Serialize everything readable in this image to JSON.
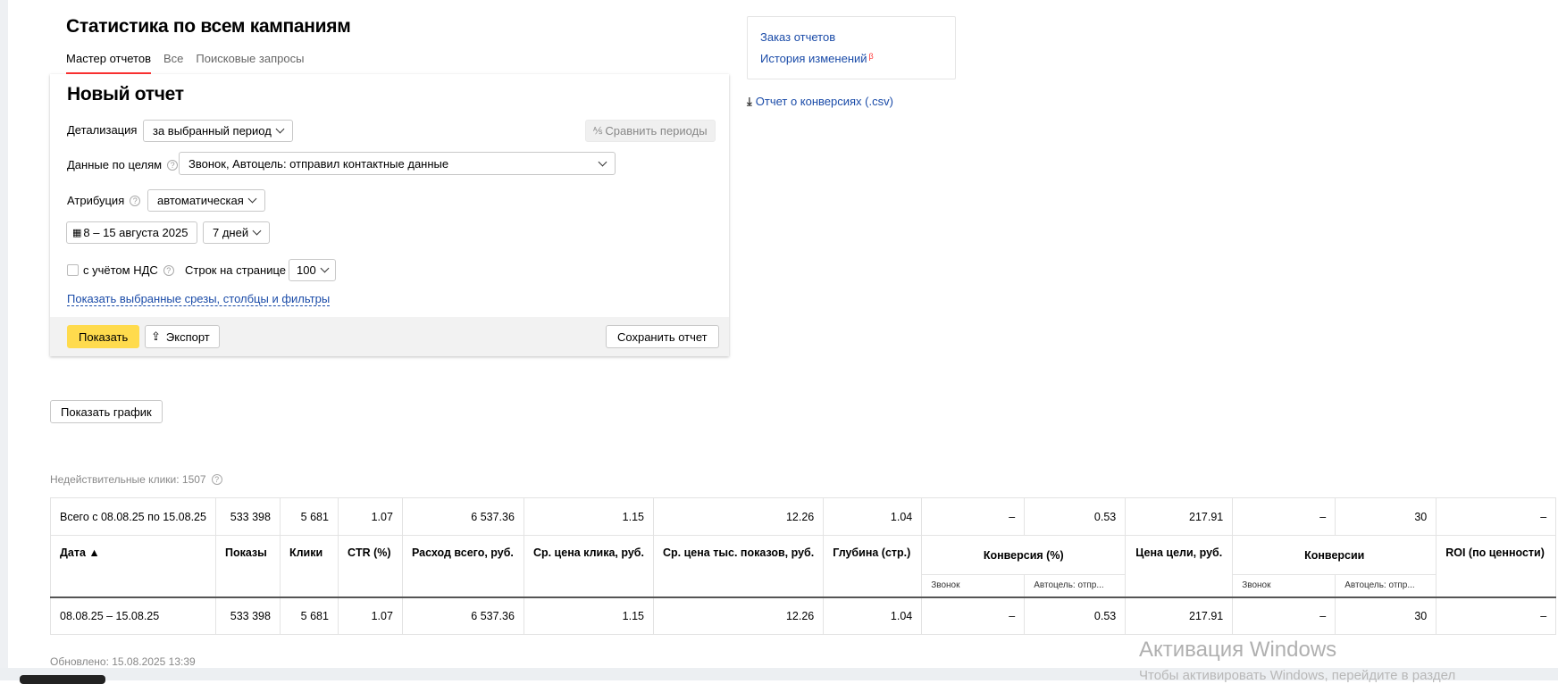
{
  "page_title": "Статистика по всем кампаниям",
  "tabs": [
    {
      "label": "Мастер отчетов",
      "active": true
    },
    {
      "label": "Все",
      "active": false
    },
    {
      "label": "Поисковые запросы",
      "active": false
    }
  ],
  "report": {
    "title": "Новый отчет",
    "detail_label": "Детализация",
    "detail_value": "за выбранный период",
    "compare_label": "Сравнить периоды",
    "goals_label": "Данные по целям",
    "goals_value": "Звонок, Автоцель: отправил контактные данные",
    "attribution_label": "Атрибуция",
    "attribution_value": "автоматическая",
    "date_range": "8 – 15 августа 2025",
    "period": "7 дней",
    "vat_label": "с учётом НДС",
    "vat_checked": false,
    "rows_label": "Строк на странице",
    "rows_value": "100",
    "show_filters_link": "Показать выбранные срезы, столбцы и фильтры",
    "show_button": "Показать",
    "export_button": "Экспорт",
    "save_button": "Сохранить отчет"
  },
  "side": {
    "order_reports": "Заказ отчетов",
    "history": "История изменений",
    "beta": "β",
    "conversions_csv": "Отчет о конверсиях (.csv)"
  },
  "show_chart_button": "Показать график",
  "invalid_clicks": "Недействительные клики: 1507",
  "table": {
    "total_row": [
      "Всего с 08.08.25 по 15.08.25",
      "533 398",
      "5 681",
      "1.07",
      "6 537.36",
      "1.15",
      "12.26",
      "1.04",
      "–",
      "0.53",
      "217.91",
      "–",
      "30",
      "–"
    ],
    "headers": {
      "date": "Дата ▲",
      "impressions": "Показы",
      "clicks": "Клики",
      "ctr": "CTR (%)",
      "cost": "Расход всего, руб.",
      "cpc": "Ср. цена клика, руб.",
      "cpm": "Ср. цена тыс. показов, руб.",
      "depth": "Глубина (стр.)",
      "conv_rate": "Конверсия (%)",
      "goal_price": "Цена цели, руб.",
      "conversions": "Конверсии",
      "roi": "ROI (по ценности)",
      "sub_call": "Звонок",
      "sub_autogoal": "Автоцель: отпр..."
    },
    "data_row": [
      "08.08.25 – 15.08.25",
      "533 398",
      "5 681",
      "1.07",
      "6 537.36",
      "1.15",
      "12.26",
      "1.04",
      "–",
      "0.53",
      "217.91",
      "–",
      "30",
      "–"
    ]
  },
  "updated": "Обновлено: 15.08.2025 13:39",
  "watermark": {
    "title": "Активация Windows",
    "subtitle": "Чтобы активировать Windows, перейдите в раздел"
  },
  "colors": {
    "accent_yellow": "#ffdb4d",
    "link_blue": "#1a4ba8",
    "tab_red": "#ff3333"
  }
}
